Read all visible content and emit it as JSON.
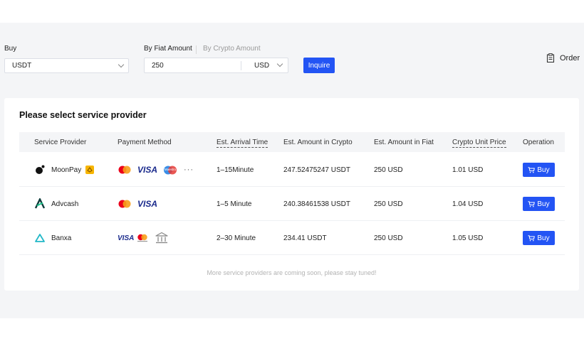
{
  "form": {
    "buy_label": "Buy",
    "crypto_value": "USDT",
    "tab_fiat": "By Fiat Amount",
    "tab_crypto": "By Crypto Amount",
    "amount_value": "250",
    "fiat_value": "USD",
    "inquire_label": "Inquire",
    "order_label": "Order"
  },
  "card": {
    "title": "Please select service provider",
    "columns": {
      "provider": "Service Provider",
      "payment": "Payment Method",
      "arrival": "Est. Arrival Time",
      "crypto_amount": "Est. Amount in Crypto",
      "fiat_amount": "Est. Amount in Fiat",
      "unit_price": "Crypto Unit Price",
      "operation": "Operation"
    },
    "rows": [
      {
        "provider": "MoonPay",
        "arrival": "1–15Minute",
        "crypto_amount": "247.52475247 USDT",
        "fiat_amount": "250 USD",
        "unit_price": "1.01 USD",
        "buy": "Buy"
      },
      {
        "provider": "Advcash",
        "arrival": "1–5 Minute",
        "crypto_amount": "240.38461538 USDT",
        "fiat_amount": "250 USD",
        "unit_price": "1.04 USD",
        "buy": "Buy"
      },
      {
        "provider": "Banxa",
        "arrival": "2–30 Minute",
        "crypto_amount": "234.41 USDT",
        "fiat_amount": "250 USD",
        "unit_price": "1.05 USD",
        "buy": "Buy"
      }
    ],
    "visa_label": "VISA",
    "maestro_label": "Maestro",
    "more_label": "···",
    "footnote": "More service providers are coming soon, please stay tuned!"
  },
  "colors": {
    "accent": "#2354f4",
    "page_bg": "#f4f5f7"
  }
}
